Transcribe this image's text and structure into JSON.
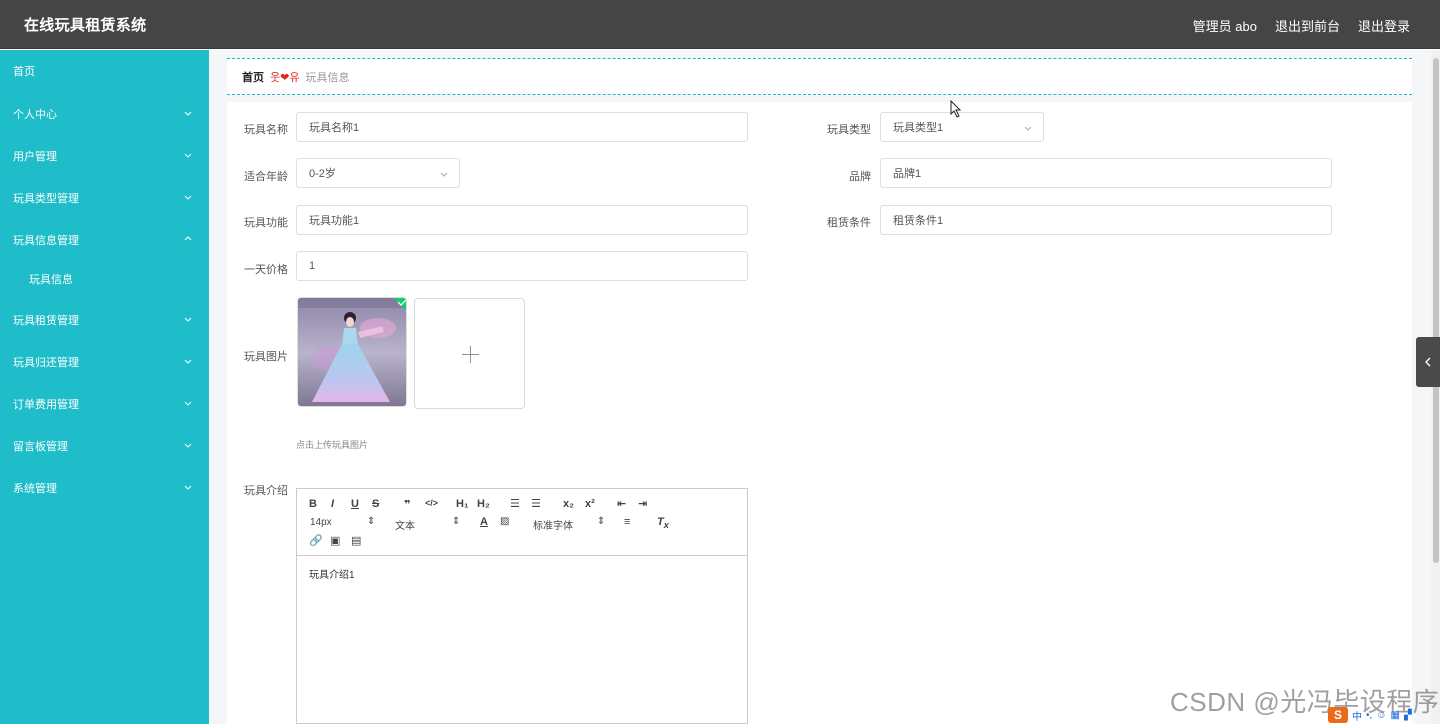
{
  "app": {
    "title": "在线玩具租赁系统",
    "user_label": "管理员 abo",
    "to_front": "退出到前台",
    "logout": "退出登录"
  },
  "sidebar": {
    "items": [
      {
        "label": "首页"
      },
      {
        "label": "个人中心"
      },
      {
        "label": "用户管理"
      },
      {
        "label": "玩具类型管理"
      },
      {
        "label": "玩具信息管理"
      },
      {
        "label": "玩具信息"
      },
      {
        "label": "玩具租赁管理"
      },
      {
        "label": "玩具归还管理"
      },
      {
        "label": "订单费用管理"
      },
      {
        "label": "留言板管理"
      },
      {
        "label": "系统管理"
      }
    ]
  },
  "breadcrumb": {
    "home": "首页",
    "separator": "❤",
    "current": "玩具信息"
  },
  "form": {
    "name_label": "玩具名称",
    "name_value": "玩具名称1",
    "type_label": "玩具类型",
    "type_value": "玩具类型1",
    "age_label": "适合年龄",
    "age_value": "0-2岁",
    "brand_label": "品牌",
    "brand_value": "品牌1",
    "function_label": "玩具功能",
    "function_value": "玩具功能1",
    "rent_cond_label": "租赁条件",
    "rent_cond_value": "租赁条件1",
    "price_label": "一天价格",
    "price_value": "1",
    "image_label": "玩具图片",
    "upload_tip": "点击上传玩具图片",
    "intro_label": "玩具介绍",
    "intro_value": "玩具介绍1"
  },
  "editor": {
    "font_size": "14px",
    "block_format": "文本",
    "font_family": "标准字体"
  },
  "watermark": "CSDN @光冯毕设程序",
  "ime": {
    "lang": "中"
  },
  "colors": {
    "topbar": "#454545",
    "sidebar": "#1ebdc9",
    "breadcrumb_border": "#1eb5cf",
    "separator_heart": "#e0231f"
  }
}
